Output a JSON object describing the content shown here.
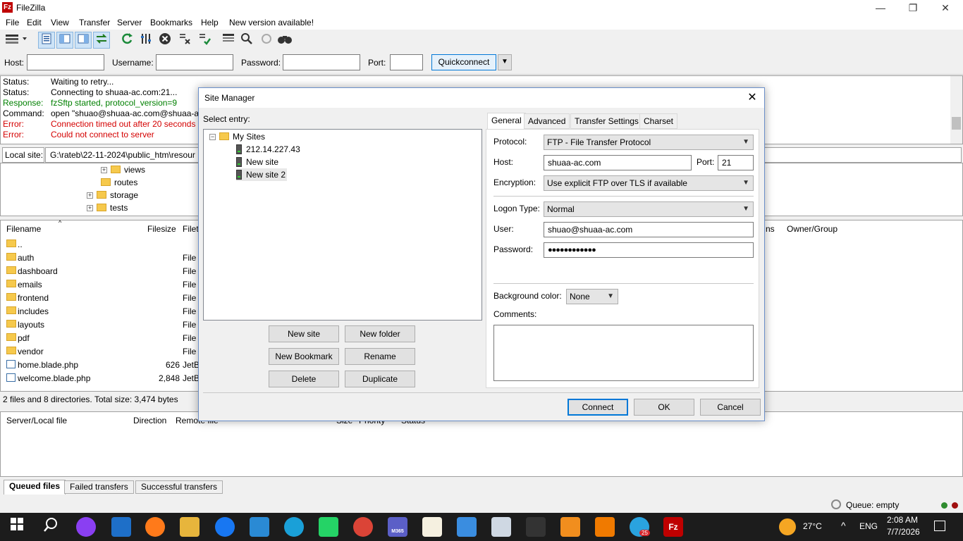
{
  "window": {
    "title": "FileZilla",
    "app_icon": "Fz",
    "minimize": "—",
    "restore": "❐",
    "close": "✕"
  },
  "menu": [
    "File",
    "Edit",
    "View",
    "Transfer",
    "Server",
    "Bookmarks",
    "Help",
    "New version available!"
  ],
  "quickconnect": {
    "host_label": "Host:",
    "host_value": "",
    "username_label": "Username:",
    "username_value": "",
    "password_label": "Password:",
    "password_value": "",
    "port_label": "Port:",
    "port_value": "",
    "button": "Quickconnect",
    "dropdown": "▼"
  },
  "log": [
    {
      "key": "Status:",
      "text": "Waiting to retry...",
      "color": "#000000"
    },
    {
      "key": "Status:",
      "text": "Connecting to shuaa-ac.com:21...",
      "color": "#000000"
    },
    {
      "key": "Response:",
      "text": "fzSftp started, protocol_version=9",
      "color": "#008000"
    },
    {
      "key": "Command:",
      "text": "open \"shuao@shuaa-ac.com@shuaa-ac",
      "color": "#000000"
    },
    {
      "key": "Error:",
      "text": "Connection timed out after 20 seconds",
      "color": "#d40000"
    },
    {
      "key": "Error:",
      "text": "Could not connect to server",
      "color": "#d40000"
    }
  ],
  "local_site": {
    "label": "Local site:",
    "path": "G:\\rateb\\22-11-2024\\public_htm\\resour"
  },
  "local_tree": [
    "views",
    "routes",
    "storage",
    "tests"
  ],
  "file_list": {
    "columns": {
      "filename": "Filename",
      "filesize": "Filesize",
      "filetype": "Filet",
      "perms": "ns",
      "owner": "Owner/Group"
    },
    "rows": [
      {
        "name": "..",
        "size": "",
        "type": "",
        "icon": "folder"
      },
      {
        "name": "auth",
        "size": "",
        "type": "File f",
        "icon": "folder"
      },
      {
        "name": "dashboard",
        "size": "",
        "type": "File f",
        "icon": "folder"
      },
      {
        "name": "emails",
        "size": "",
        "type": "File f",
        "icon": "folder"
      },
      {
        "name": "frontend",
        "size": "",
        "type": "File f",
        "icon": "folder"
      },
      {
        "name": "includes",
        "size": "",
        "type": "File f",
        "icon": "folder"
      },
      {
        "name": "layouts",
        "size": "",
        "type": "File f",
        "icon": "folder"
      },
      {
        "name": "pdf",
        "size": "",
        "type": "File f",
        "icon": "folder"
      },
      {
        "name": "vendor",
        "size": "",
        "type": "File f",
        "icon": "folder"
      },
      {
        "name": "home.blade.php",
        "size": "626",
        "type": "JetBr",
        "icon": "file"
      },
      {
        "name": "welcome.blade.php",
        "size": "2,848",
        "type": "JetBr",
        "icon": "file"
      }
    ],
    "summary": "2 files and 8 directories. Total size: 3,474 bytes"
  },
  "queue": {
    "columns": [
      "Server/Local file",
      "Direction",
      "Remote file",
      "Size",
      "Priority",
      "Status"
    ],
    "tabs": [
      "Queued files",
      "Failed transfers",
      "Successful transfers"
    ],
    "status": "Queue: empty"
  },
  "site_manager": {
    "title": "Site Manager",
    "close": "✕",
    "select_entry": "Select entry:",
    "tree_root": "My Sites",
    "sites": [
      "212.14.227.43",
      "New site",
      "New site 2"
    ],
    "buttons": {
      "new_site": "New site",
      "new_folder": "New folder",
      "new_bookmark": "New Bookmark",
      "rename": "Rename",
      "delete": "Delete",
      "duplicate": "Duplicate",
      "connect": "Connect",
      "ok": "OK",
      "cancel": "Cancel"
    },
    "tabs": [
      "General",
      "Advanced",
      "Transfer Settings",
      "Charset"
    ],
    "general": {
      "protocol_label": "Protocol:",
      "protocol_value": "FTP - File Transfer Protocol",
      "host_label": "Host:",
      "host_value": "shuaa-ac.com",
      "port_label": "Port:",
      "port_value": "21",
      "encryption_label": "Encryption:",
      "encryption_value": "Use explicit FTP over TLS if available",
      "logon_label": "Logon Type:",
      "logon_value": "Normal",
      "user_label": "User:",
      "user_value": "shuao@shuaa-ac.com",
      "password_label": "Password:",
      "password_value": "●●●●●●●●●●●●",
      "bgcolor_label": "Background color:",
      "bgcolor_value": "None",
      "comments_label": "Comments:",
      "comments_value": ""
    }
  },
  "taskbar": {
    "weather": "27°C",
    "lang": "ENG",
    "time": "2:08 AM",
    "date": "7/7/2026",
    "icons": [
      "windows-start",
      "search",
      "messenger",
      "file-explorer-alt",
      "firefox",
      "file-explorer",
      "messenger-blue",
      "vscode",
      "edge",
      "whatsapp",
      "chrome",
      "m365",
      "app-tree",
      "photos",
      "keyboard",
      "terminal",
      "xampp",
      "vlc",
      "telegram",
      "filezilla"
    ],
    "telegram_badge": "25",
    "m365_label": "M365"
  }
}
